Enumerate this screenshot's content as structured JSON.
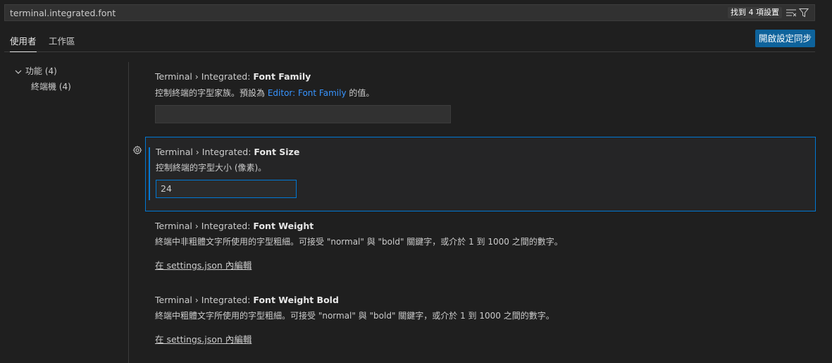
{
  "search": {
    "value": "terminal.integrated.font",
    "result_count": "找到 4 項設置"
  },
  "tabs": [
    {
      "label": "使用者",
      "active": true
    },
    {
      "label": "工作區",
      "active": false
    }
  ],
  "sync_button": "開啟設定同步",
  "toc": {
    "items": [
      {
        "label": "功能 (4)",
        "expanded": true
      },
      {
        "label": "終端機 (4)"
      }
    ]
  },
  "settings": [
    {
      "category": "Terminal › Integrated: ",
      "name": "Font Family",
      "desc_before": "控制終端的字型家族。預設為 ",
      "desc_link": "Editor: Font Family",
      "desc_after": " 的值。",
      "value": ""
    },
    {
      "category": "Terminal › Integrated: ",
      "name": "Font Size",
      "desc": "控制終端的字型大小 (像素)。",
      "value": "24"
    },
    {
      "category": "Terminal › Integrated: ",
      "name": "Font Weight",
      "desc": "終端中非粗體文字所使用的字型粗細。可接受 \"normal\" 與 \"bold\" 關鍵字，或介於 1 到 1000 之間的數字。",
      "edit_link": "在 settings.json 內編輯"
    },
    {
      "category": "Terminal › Integrated: ",
      "name": "Font Weight Bold",
      "desc": "終端中粗體文字所使用的字型粗細。可接受 \"normal\" 與 \"bold\" 關鍵字，或介於 1 到 1000 之間的數字。",
      "edit_link": "在 settings.json 內編輯"
    }
  ],
  "colors": {
    "accent": "#0078d4",
    "link": "#3794ff",
    "button": "#0e639c"
  }
}
